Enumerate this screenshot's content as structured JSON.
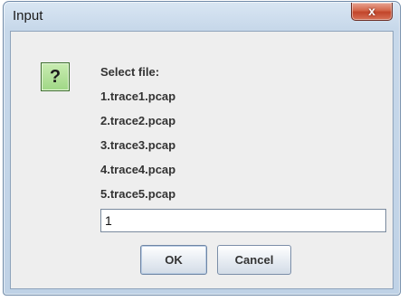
{
  "window": {
    "title": "Input",
    "close_glyph": "x",
    "accent_color": "#c2452a"
  },
  "dialog": {
    "icon": "question-icon",
    "icon_glyph": "?",
    "message_lines": [
      "Select file:",
      "1.trace1.pcap",
      "2.trace2.pcap",
      "3.trace3.pcap",
      "4.trace4.pcap",
      "5.trace5.pcap"
    ],
    "input_value": "1"
  },
  "buttons": {
    "ok_label": "OK",
    "cancel_label": "Cancel"
  }
}
